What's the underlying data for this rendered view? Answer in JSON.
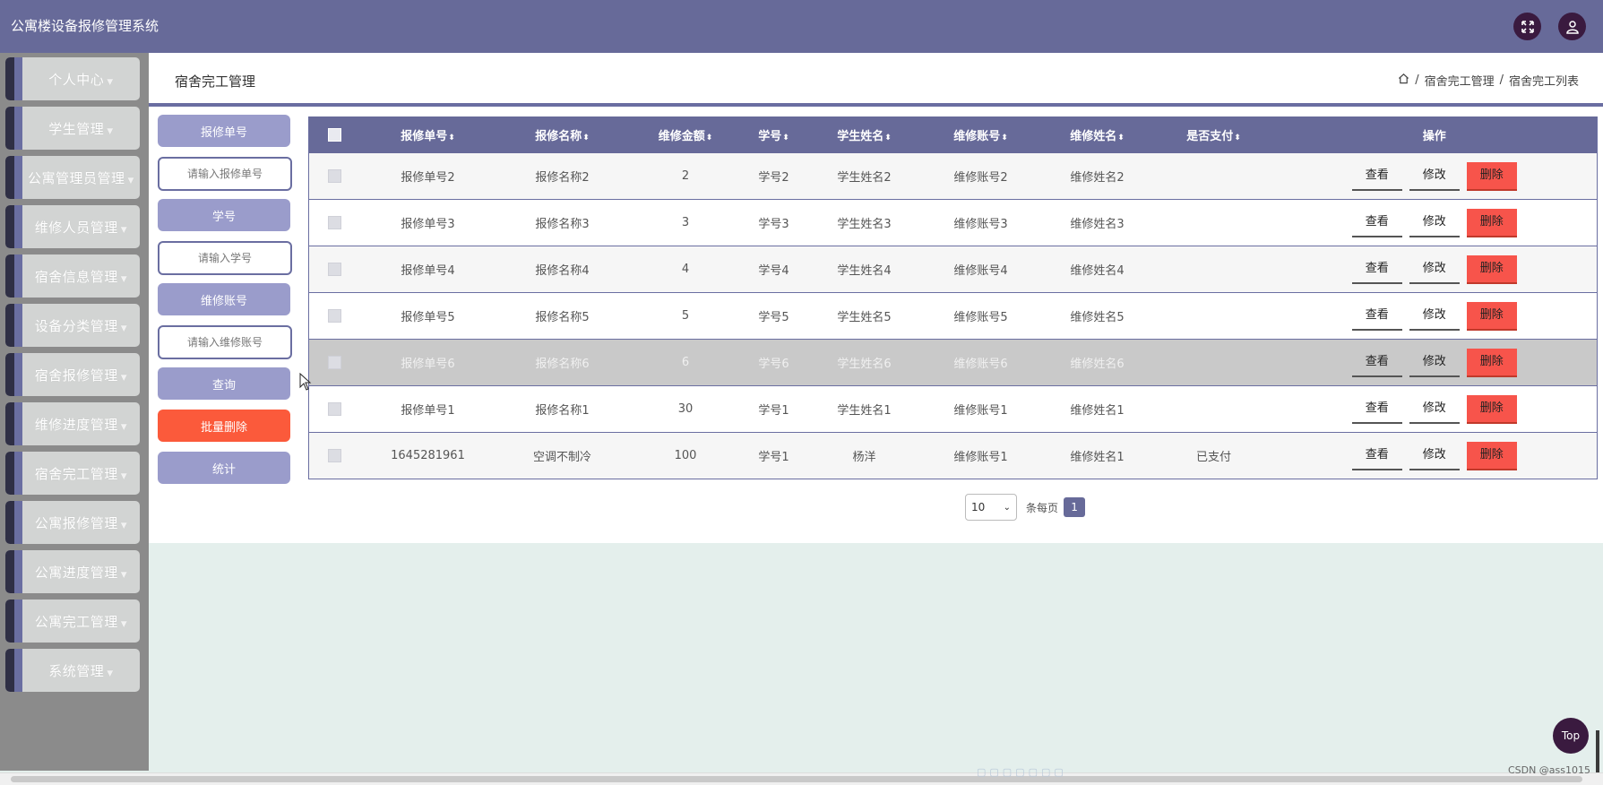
{
  "app": {
    "title": "公寓楼设备报修管理系统"
  },
  "header_icons": {
    "fullscreen": "fullscreen-icon",
    "user": "user-icon"
  },
  "sidebar": {
    "items": [
      {
        "label": "个人中心"
      },
      {
        "label": "学生管理"
      },
      {
        "label": "公寓管理员管理"
      },
      {
        "label": "维修人员管理"
      },
      {
        "label": "宿舍信息管理"
      },
      {
        "label": "设备分类管理"
      },
      {
        "label": "宿舍报修管理"
      },
      {
        "label": "维修进度管理"
      },
      {
        "label": "宿舍完工管理"
      },
      {
        "label": "公寓报修管理"
      },
      {
        "label": "公寓进度管理"
      },
      {
        "label": "公寓完工管理"
      },
      {
        "label": "系统管理"
      }
    ]
  },
  "page": {
    "title": "宿舍完工管理",
    "breadcrumb": [
      "宿舍完工管理",
      "宿舍完工列表"
    ]
  },
  "search": {
    "field1_label": "报修单号",
    "field1_placeholder": "请输入报修单号",
    "field2_label": "学号",
    "field2_placeholder": "请输入学号",
    "field3_label": "维修账号",
    "field3_placeholder": "请输入维修账号",
    "query_label": "查询",
    "batch_delete_label": "批量删除",
    "stats_label": "统计"
  },
  "table": {
    "headers": [
      "报修单号",
      "报修名称",
      "维修金额",
      "学号",
      "学生姓名",
      "维修账号",
      "维修姓名",
      "是否支付",
      "操作"
    ],
    "actions": {
      "view": "查看",
      "edit": "修改",
      "delete": "删除"
    },
    "rows": [
      [
        "报修单号2",
        "报修名称2",
        "2",
        "学号2",
        "学生姓名2",
        "维修账号2",
        "维修姓名2",
        ""
      ],
      [
        "报修单号3",
        "报修名称3",
        "3",
        "学号3",
        "学生姓名3",
        "维修账号3",
        "维修姓名3",
        ""
      ],
      [
        "报修单号4",
        "报修名称4",
        "4",
        "学号4",
        "学生姓名4",
        "维修账号4",
        "维修姓名4",
        ""
      ],
      [
        "报修单号5",
        "报修名称5",
        "5",
        "学号5",
        "学生姓名5",
        "维修账号5",
        "维修姓名5",
        ""
      ],
      [
        "报修单号6",
        "报修名称6",
        "6",
        "学号6",
        "学生姓名6",
        "维修账号6",
        "维修姓名6",
        ""
      ],
      [
        "报修单号1",
        "报修名称1",
        "30",
        "学号1",
        "学生姓名1",
        "维修账号1",
        "维修姓名1",
        ""
      ],
      [
        "1645281961",
        "空调不制冷",
        "100",
        "学号1",
        "杨洋",
        "维修账号1",
        "维修姓名1",
        "已支付"
      ]
    ]
  },
  "pagination": {
    "page_size": "10",
    "per_page_label": "条每页",
    "current_page": "1"
  },
  "misc": {
    "top_button": "Top",
    "watermark": "CSDN @ass1015"
  },
  "colors": {
    "primary": "#676a99",
    "danger": "#fb5a3b",
    "delete_button": "#f7544b",
    "background": "#e4efec"
  }
}
